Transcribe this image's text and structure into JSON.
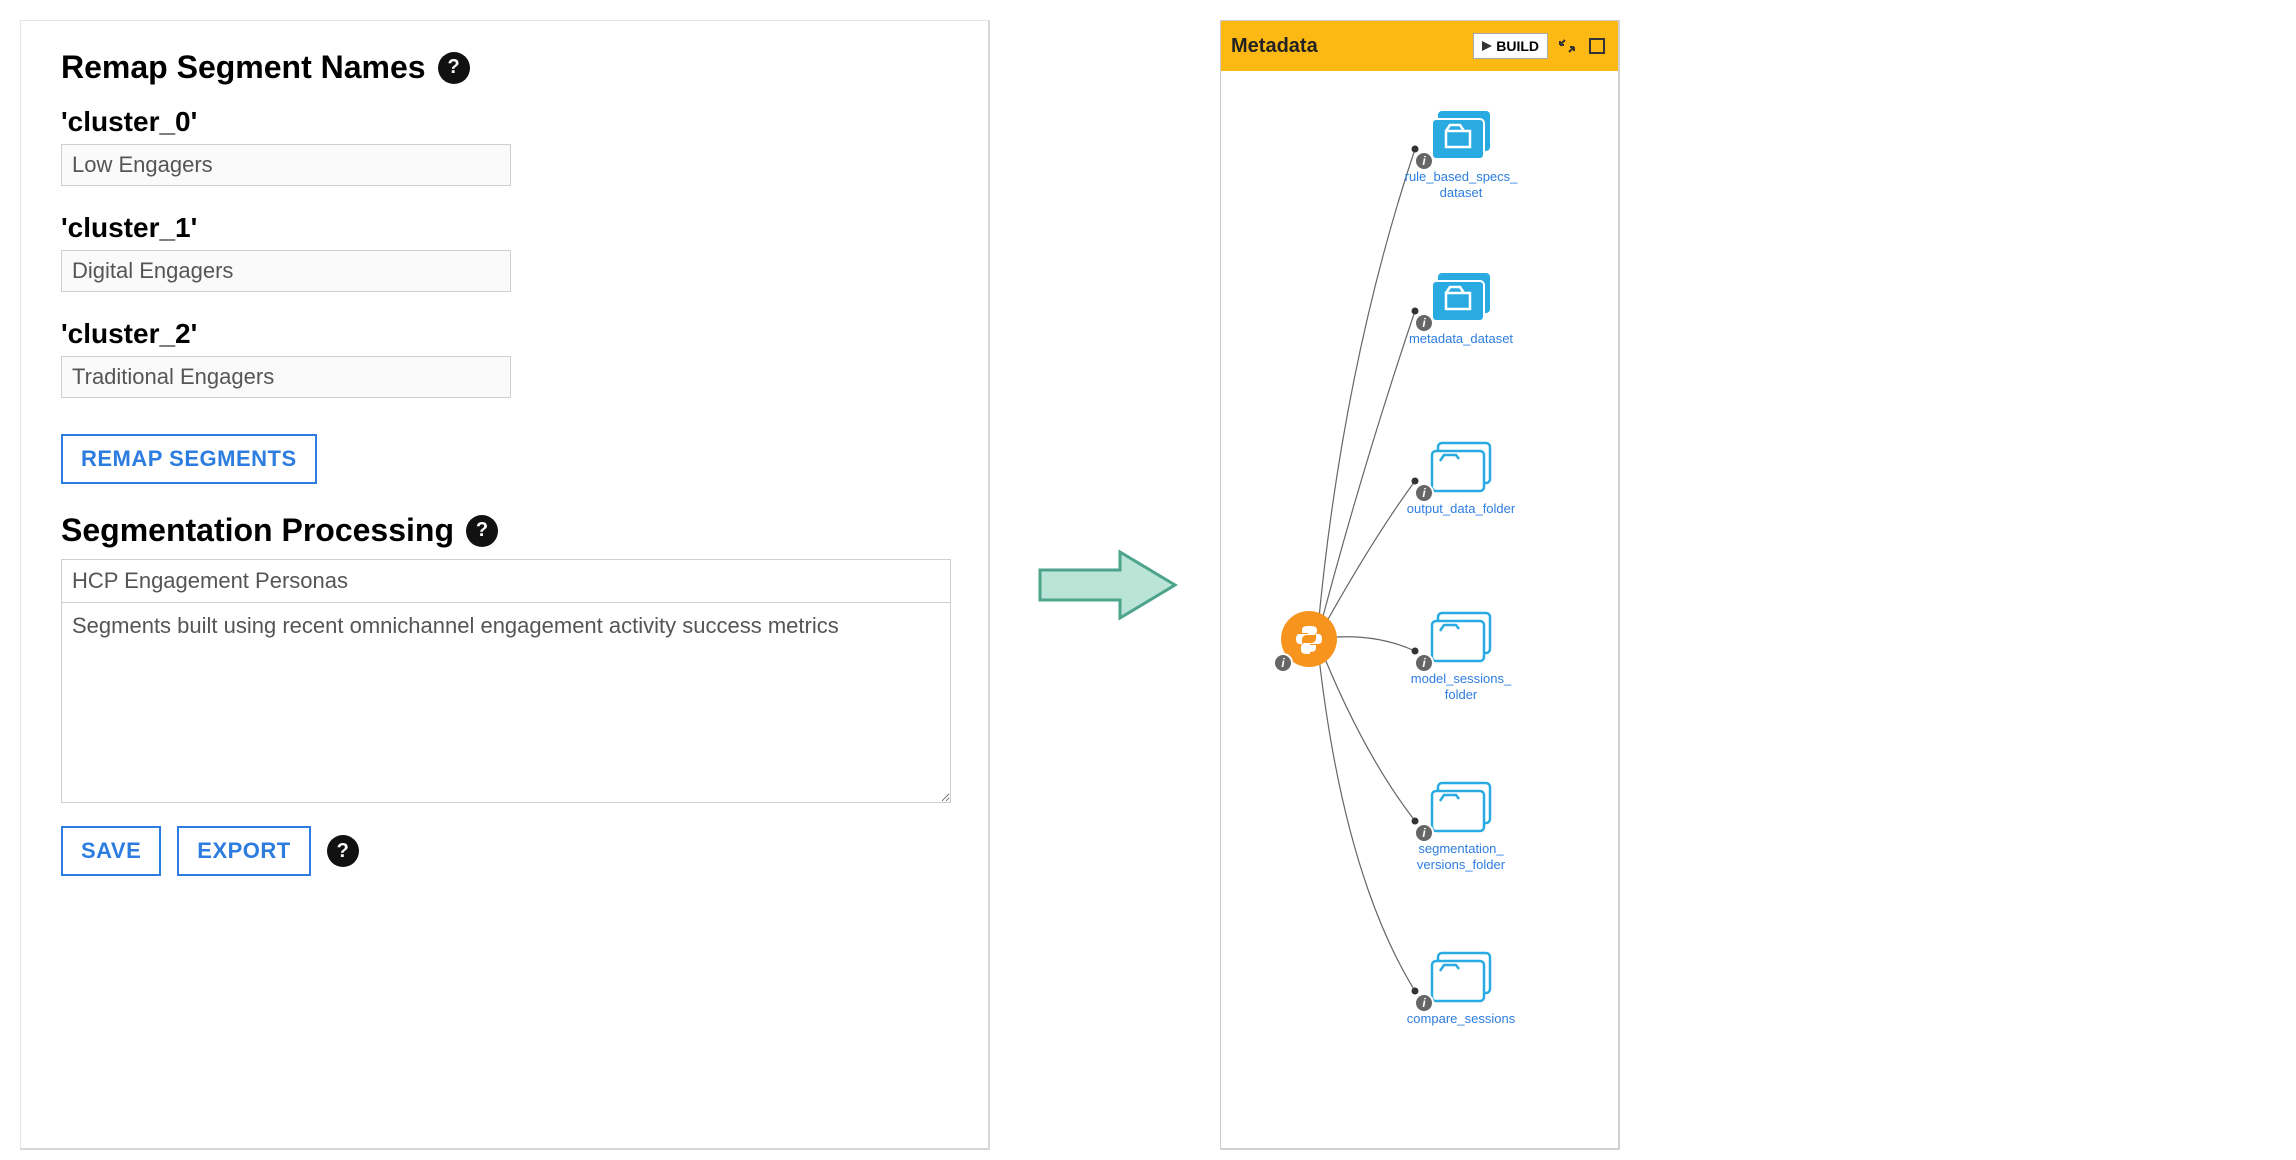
{
  "left": {
    "remap_title": "Remap Segment Names",
    "clusters": [
      {
        "key": "'cluster_0'",
        "value": "Low Engagers"
      },
      {
        "key": "'cluster_1'",
        "value": "Digital Engagers"
      },
      {
        "key": "'cluster_2'",
        "value": "Traditional Engagers"
      }
    ],
    "remap_button": "REMAP SEGMENTS",
    "proc_title": "Segmentation Processing",
    "proc_name_value": "HCP Engagement Personas",
    "proc_desc_value": "Segments built using recent omnichannel engagement activity success metrics",
    "save_button": "SAVE",
    "export_button": "EXPORT"
  },
  "right": {
    "panel_title": "Metadata",
    "build_button": "BUILD",
    "nodes": [
      {
        "label": "rule_based_specs_dataset",
        "filled": true
      },
      {
        "label": "metadata_dataset",
        "filled": true
      },
      {
        "label": "output_data_folder",
        "filled": false
      },
      {
        "label": "model_sessions_folder",
        "filled": false
      },
      {
        "label": "segmentation_versions_folder",
        "filled": false
      },
      {
        "label": "compare_sessions",
        "filled": false
      }
    ]
  },
  "colors": {
    "accent": "#2d7de0",
    "orange": "#f7941e",
    "amber": "#fdb913",
    "filled_folder": "#29abe2"
  }
}
